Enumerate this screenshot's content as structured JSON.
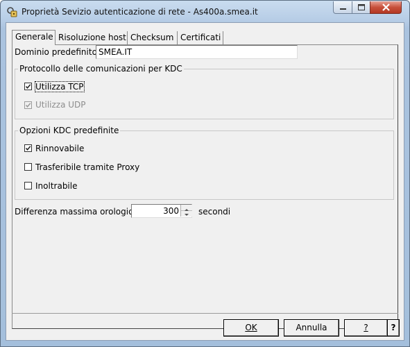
{
  "window": {
    "title": "Proprietà Sevizio autenticazione di rete - As400a.smea.it",
    "icon": "key-lock-icon"
  },
  "tabs": [
    {
      "label": "Generale",
      "active": true
    },
    {
      "label": "Risoluzione host",
      "active": false
    },
    {
      "label": "Checksum",
      "active": false
    },
    {
      "label": "Certificati",
      "active": false
    }
  ],
  "domain": {
    "label": "Dominio predefinito:",
    "value": "SMEA.IT"
  },
  "protocol_group": {
    "title": "Protocollo delle comunicazioni per KDC",
    "items": [
      {
        "label": "Utilizza TCP",
        "checked": true,
        "enabled": true
      },
      {
        "label": "Utilizza UDP",
        "checked": true,
        "enabled": false
      }
    ]
  },
  "options_group": {
    "title": "Opzioni KDC predefinite",
    "items": [
      {
        "label": "Rinnovabile",
        "checked": true,
        "enabled": true
      },
      {
        "label": "Trasferibile tramite Proxy",
        "checked": false,
        "enabled": true
      },
      {
        "label": "Inoltrabile",
        "checked": false,
        "enabled": true
      }
    ]
  },
  "clock_skew": {
    "label": "Differenza massima orologio:",
    "value": "300",
    "unit": "secondi"
  },
  "buttons": {
    "ok": "OK",
    "cancel": "Annulla",
    "help": "?",
    "whats_this": "?"
  }
}
